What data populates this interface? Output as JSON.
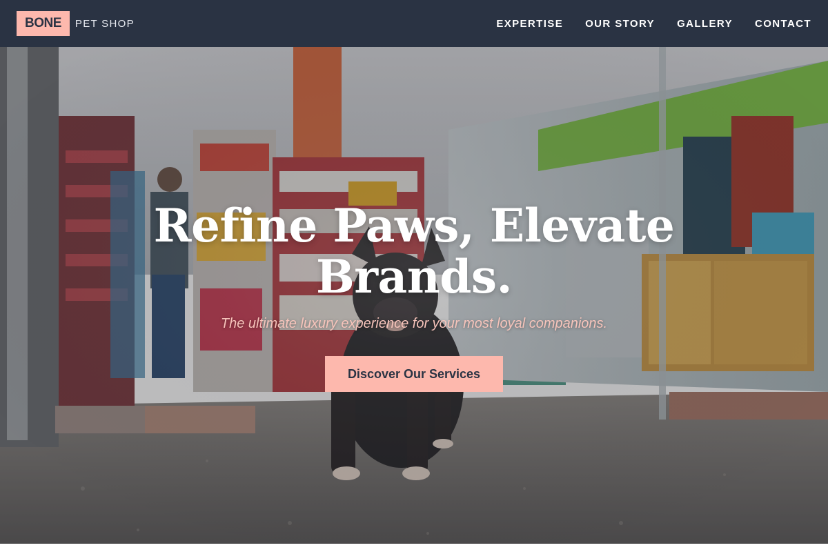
{
  "header": {
    "logo_main": "BONE",
    "logo_sub": "PET SHOP",
    "nav": [
      {
        "label": "EXPERTISE"
      },
      {
        "label": "OUR STORY"
      },
      {
        "label": "GALLERY"
      },
      {
        "label": "CONTACT"
      }
    ]
  },
  "hero": {
    "title_line1": "Refine Paws, Elevate",
    "title_line2": "Brands.",
    "subtitle": "The ultimate luxury experience for your most loyal companions.",
    "cta_label": "Discover Our Services"
  },
  "colors": {
    "header_bg": "#2a3343",
    "accent": "#fdb8ad",
    "subtitle": "#f7c4bb"
  }
}
